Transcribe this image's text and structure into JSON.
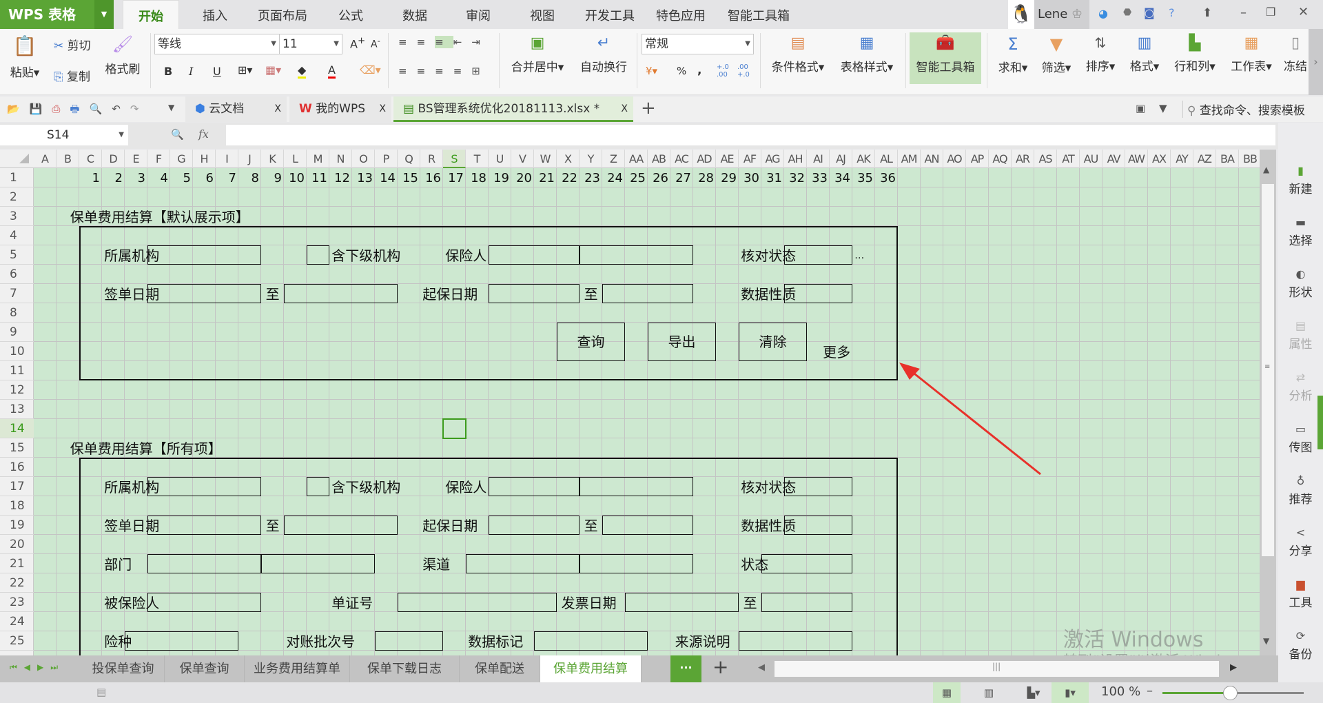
{
  "app": {
    "logo": "WPS 表格",
    "user": "Lene"
  },
  "menu_tabs": [
    "开始",
    "插入",
    "页面布局",
    "公式",
    "数据",
    "审阅",
    "视图",
    "开发工具",
    "特色应用",
    "智能工具箱"
  ],
  "ribbon": {
    "paste": "粘贴",
    "cut": "剪切",
    "copy": "复制",
    "format_painter": "格式刷",
    "font_name": "等线",
    "font_size": "11",
    "bold": "B",
    "italic": "I",
    "underline": "U",
    "merge_center": "合并居中",
    "wrap_text": "自动换行",
    "number_format": "常规",
    "percent": "%",
    "comma": ",",
    "conditional_format": "条件格式",
    "table_style": "表格样式",
    "smart_toolbox": "智能工具箱",
    "sum": "求和",
    "filter": "筛选",
    "sort": "排序",
    "format": "格式",
    "rows_cols": "行和列",
    "worksheet": "工作表",
    "freeze": "冻结"
  },
  "doc_tabs": [
    {
      "label": "云文档",
      "close": "X"
    },
    {
      "label": "我的WPS",
      "close": "X"
    },
    {
      "label": "BS管理系统优化20181113.xlsx *",
      "close": "X",
      "active": true
    }
  ],
  "search_commands": "查找命令、搜索模板",
  "formula_bar": {
    "name_box": "S14",
    "fx": "fx",
    "value": ""
  },
  "sheet": {
    "columns": [
      "A",
      "B",
      "C",
      "D",
      "E",
      "F",
      "G",
      "H",
      "I",
      "J",
      "K",
      "L",
      "M",
      "N",
      "O",
      "P",
      "Q",
      "R",
      "S",
      "T",
      "U",
      "V",
      "W",
      "X",
      "Y",
      "Z",
      "AA",
      "AB",
      "AC",
      "AD",
      "AE",
      "AF",
      "AG",
      "AH",
      "AI",
      "AJ",
      "AK",
      "AL",
      "AM",
      "AN",
      "AO",
      "AP",
      "AQ",
      "AR",
      "AS",
      "AT",
      "AU",
      "AV",
      "AW",
      "AX",
      "AY",
      "AZ",
      "BA",
      "BB"
    ],
    "rows": [
      "1",
      "2",
      "3",
      "4",
      "5",
      "6",
      "7",
      "8",
      "9",
      "10",
      "11",
      "12",
      "13",
      "14",
      "15",
      "16",
      "17",
      "18",
      "19",
      "20",
      "21",
      "22",
      "23",
      "24",
      "25"
    ],
    "selected_cell": "S14",
    "row1_values": [
      "1",
      "2",
      "3",
      "4",
      "5",
      "6",
      "7",
      "8",
      "9",
      "10",
      "11",
      "12",
      "13",
      "14",
      "15",
      "16",
      "17",
      "18",
      "19",
      "20",
      "21",
      "22",
      "23",
      "24",
      "25",
      "26",
      "27",
      "28",
      "29",
      "30",
      "31",
      "32",
      "33",
      "34",
      "35",
      "36"
    ]
  },
  "form_default": {
    "title": "保单费用结算【默认展示项】",
    "org": "所属机构",
    "include_sub": "含下级机构",
    "insurer": "保险人",
    "check_status": "核对状态",
    "ellipsis": "…",
    "sign_date": "签单日期",
    "to": "至",
    "start_date": "起保日期",
    "data_nature": "数据性质",
    "query": "查询",
    "export": "导出",
    "clear": "清除",
    "more": "更多"
  },
  "form_all": {
    "title": "保单费用结算【所有项】",
    "org": "所属机构",
    "include_sub": "含下级机构",
    "insurer": "保险人",
    "check_status": "核对状态",
    "sign_date": "签单日期",
    "to": "至",
    "start_date": "起保日期",
    "data_nature": "数据性质",
    "dept": "部门",
    "channel": "渠道",
    "status": "状态",
    "insured": "被保险人",
    "doc_no": "单证号",
    "invoice_date": "发票日期",
    "insurance_type": "险种",
    "recon_batch": "对账批次号",
    "data_mark": "数据标记",
    "source_desc": "来源说明"
  },
  "sidebar": [
    "新建",
    "选择",
    "形状",
    "属性",
    "分析",
    "传图",
    "推荐",
    "分享",
    "工具",
    "备份"
  ],
  "sheet_tabs": [
    "投保单查询",
    "保单查询",
    "业务费用结算单",
    "保单下载日志",
    "保单配送",
    "保单费用结算"
  ],
  "sheet_more": "···",
  "zoom": {
    "label": "100 %",
    "percent": 100
  },
  "watermark": {
    "line1": "激活 Windows",
    "line2": "转到“设置”以激活 Windows。"
  },
  "colors": {
    "brand": "#5ba535",
    "sheet_bg": "#cde8d0",
    "arrow": "#e8312a"
  }
}
